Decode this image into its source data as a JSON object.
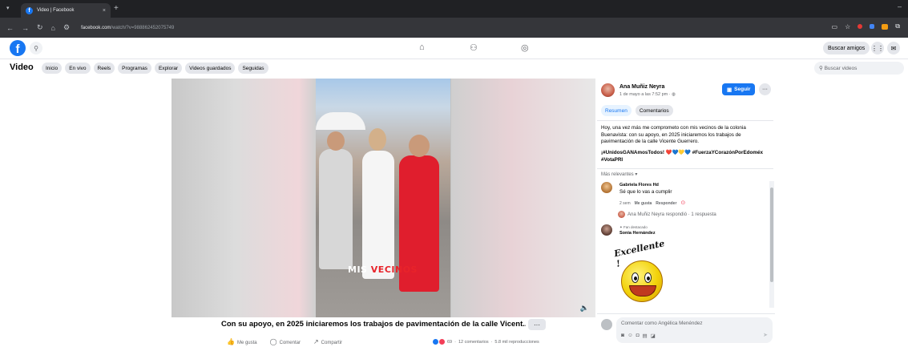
{
  "browser": {
    "tab_title": "Video | Facebook",
    "tab_close": "×",
    "new_tab": "+",
    "url_domain": "facebook.com",
    "url_path": "/watch/?v=988862452075749",
    "menu_glyph": "▾",
    "min_glyph": "–"
  },
  "fb_nav": {
    "logo": "f",
    "find_friends": "Buscar amigos"
  },
  "video_nav": {
    "title": "Video",
    "tabs": [
      {
        "label": "Inicio"
      },
      {
        "label": "En vivo"
      },
      {
        "label": "Reels"
      },
      {
        "label": "Programas"
      },
      {
        "label": "Explorar"
      },
      {
        "label": "Videos guardados"
      },
      {
        "label": "Seguidas"
      }
    ],
    "search_placeholder": "Buscar videos"
  },
  "video": {
    "caption_white": "MIS ",
    "caption_red": "VECINOS",
    "title": "Con su apoyo, en 2025 iniciaremos los trabajos de pavimentación de la calle Vicent...",
    "more": "···",
    "actions": {
      "like": "Me gusta",
      "comment": "Comentar",
      "share": "Compartir"
    },
    "stats": {
      "reactions": "69",
      "comments": "12 comentarios",
      "views": "5.8 mil reproducciones",
      "sep": "·"
    }
  },
  "post": {
    "author": "Ana Muñiz Neyra",
    "date": "1 de mayo a las 7:52 pm · ◍",
    "follow": "Seguir",
    "more": "···",
    "tabs": [
      {
        "label": "Resumen"
      },
      {
        "label": "Comentarios"
      }
    ],
    "text": "Hoy, una vez más me comprometo con mis vecinos de la colonia Buenavista: con su apoyo, en 2025 iniciaremos los trabajos de pavimentación de la calle Vicente Guerrero.",
    "tags": "¡#UnidosGANAmosTodos! ❤️💙💛💙 #FuerzaYCorazónPorEdoméx #VotaPRI",
    "relevance": "Más relevantes ▾"
  },
  "comments": [
    {
      "name": "Gabriela Flores Hd",
      "text": "Sé que lo vas a cumplir",
      "time": "2 sem",
      "like": "Me gusta",
      "reply": "Responder",
      "replied": "Ana Muñiz Neyra respondió · 1 respuesta"
    },
    {
      "badge": "✦ Fan destacado",
      "name": "Sonia Hernández",
      "sticker_text": "Excellente !"
    }
  ],
  "comment_box": {
    "placeholder": "Comentar como Angélica Menéndez"
  },
  "colors": {
    "brand": "#1877f2",
    "chrome": "#35363a"
  }
}
